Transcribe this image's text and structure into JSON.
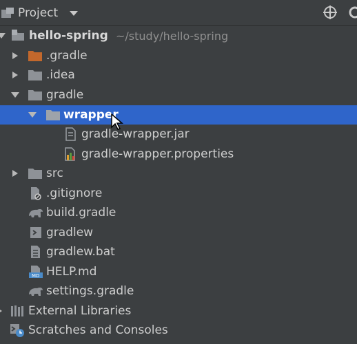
{
  "header": {
    "title": "Project"
  },
  "tree": {
    "root": {
      "label": "hello-spring",
      "path": "~/study/hello-spring"
    },
    "items": [
      {
        "label": ".gradle"
      },
      {
        "label": ".idea"
      },
      {
        "label": "gradle"
      },
      {
        "label": "wrapper"
      },
      {
        "label": "gradle-wrapper.jar"
      },
      {
        "label": "gradle-wrapper.properties"
      },
      {
        "label": "src"
      },
      {
        "label": ".gitignore"
      },
      {
        "label": "build.gradle"
      },
      {
        "label": "gradlew"
      },
      {
        "label": "gradlew.bat"
      },
      {
        "label": "HELP.md"
      },
      {
        "label": "settings.gradle"
      }
    ],
    "external_libraries": "External Libraries",
    "scratches": "Scratches and Consoles"
  },
  "colors": {
    "background": "#3c3f41",
    "selection": "#2f65ca",
    "folder": "#8e9297",
    "orange_folder": "#c3682c"
  }
}
